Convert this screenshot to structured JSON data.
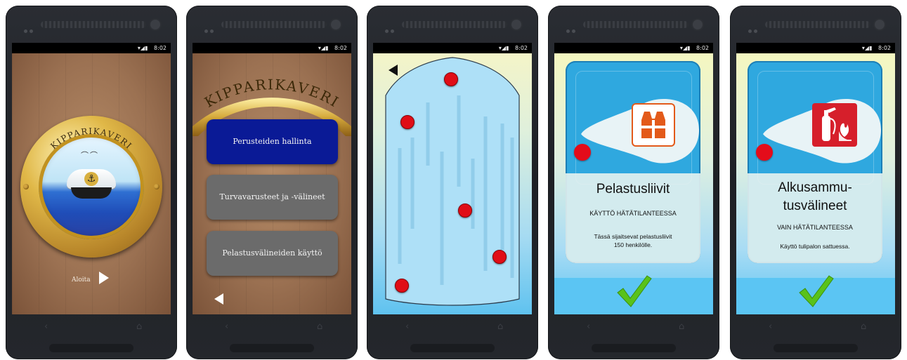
{
  "status": {
    "time": "8:02"
  },
  "screen1": {
    "title": "KIPPARIKAVERI",
    "start_label": "Aloita"
  },
  "screen2": {
    "title": "KIPPARIKAVERI",
    "buttons": [
      {
        "label": "Perusteiden hallinta"
      },
      {
        "label": "Turvavarusteet ja -välineet"
      },
      {
        "label": "Pelastusvälineiden käyttö"
      }
    ]
  },
  "screen4": {
    "title": "Pelastusliivit",
    "subtitle": "KÄYTTÖ HÄTÄTILANTEESSA",
    "description_line1": "Tässä sijaitsevat pelastusliivit",
    "description_line2": "150 henkilölle."
  },
  "screen5": {
    "title_line1": "Alkusammu-",
    "title_line2": "tusvälineet",
    "subtitle": "VAIN HÄTÄTILANTEESSA",
    "description": "Käyttö tulipalon sattuessa."
  },
  "colors": {
    "primary_button": "#0a1a96",
    "secondary_button": "#6b6b6b",
    "marker_red": "#e00d16",
    "icon_orange": "#e35a1a",
    "icon_red": "#d61f2b",
    "check_green": "#59c21a"
  },
  "icons": [
    "anchor-icon",
    "play-icon",
    "back-icon",
    "life-vest-icon",
    "fire-extinguisher-icon",
    "checkmark-icon"
  ]
}
